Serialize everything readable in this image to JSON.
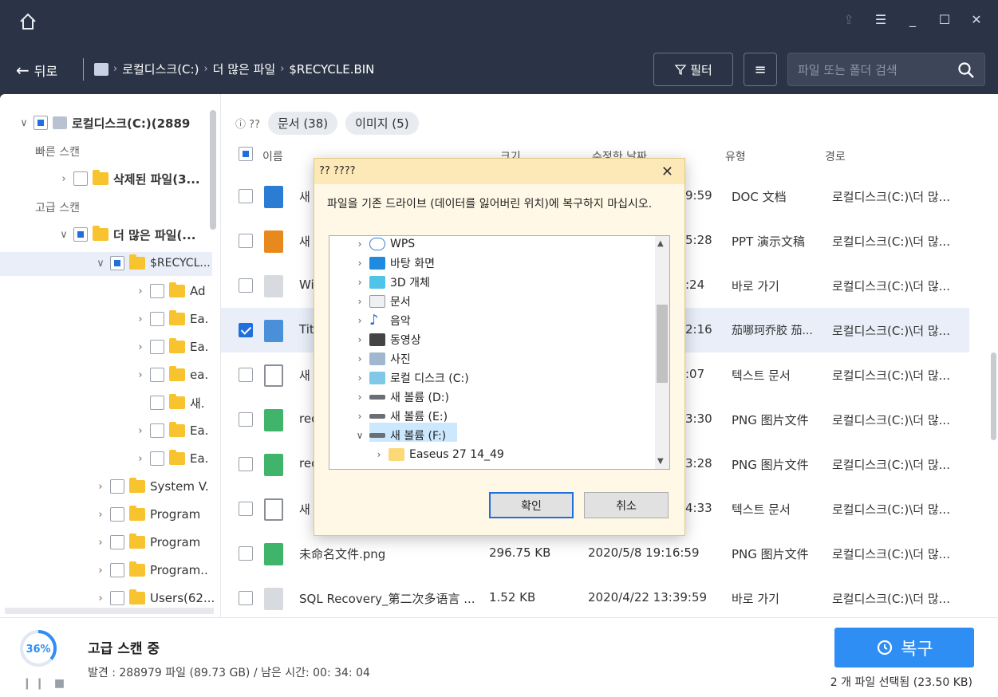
{
  "nav": {
    "back_label": "뒤로",
    "crumbs": [
      "로컬디스크(C:)",
      "더 많은 파일",
      "$RECYCLE.BIN"
    ],
    "filter_label": "필터",
    "search_placeholder": "파일 또는 폴더 검색"
  },
  "tree": {
    "root_label": "로컬디스크(C:)(2889",
    "quick_scan": "빠른 스캔",
    "deleted_files": "삭제된 파일(3...",
    "advanced_scan": "고급 스캔",
    "more_files": "더 많은 파일(...",
    "recycle": "$RECYCL...",
    "sub": [
      "Ad",
      "Ea.",
      "Ea.",
      "ea.",
      "새.",
      "Ea.",
      "Ea."
    ],
    "top": [
      "System V.",
      "Program",
      "Program",
      "Program..",
      "Users(62..."
    ]
  },
  "filters": {
    "help": "??",
    "documents": "문서 (38)",
    "images": "이미지 (5)"
  },
  "columns": {
    "name": "이름",
    "size": "크기",
    "date": "수정한 날짜",
    "type": "유형",
    "path": "경로"
  },
  "rows": [
    {
      "name": "새",
      "time": "9:59",
      "type": "DOC 文档",
      "path": "로컬디스크(C:)\\더 많..."
    },
    {
      "name": "새",
      "time": "5:28",
      "type": "PPT 演示文稿",
      "path": "로컬디스크(C:)\\더 많..."
    },
    {
      "name": "Wi",
      "time": ":24",
      "type": "바로 가기",
      "path": "로컬디스크(C:)\\더 많..."
    },
    {
      "name": "Tit",
      "time": "2:16",
      "type": "茄哪珂乔胶 茄...",
      "path": "로컬디스크(C:)\\더 많..."
    },
    {
      "name": "새",
      "time": ":07",
      "type": "텍스트 문서",
      "path": "로컬디스크(C:)\\더 많..."
    },
    {
      "name": "rec",
      "time": "3:30",
      "type": "PNG 图片文件",
      "path": "로컬디스크(C:)\\더 많..."
    },
    {
      "name": "rec",
      "time": "3:28",
      "type": "PNG 图片文件",
      "path": "로컬디스크(C:)\\더 많..."
    },
    {
      "name": "새",
      "time": "4:33",
      "type": "텍스트 문서",
      "path": "로컬디스크(C:)\\더 많..."
    },
    {
      "name": "未命名文件.png",
      "size": "296.75 KB",
      "date": "2020/5/8 19:16:59",
      "type": "PNG 图片文件",
      "path": "로컬디스크(C:)\\더 많..."
    },
    {
      "name": "SQL Recovery_第二次多语言 ...",
      "size": "1.52 KB",
      "date": "2020/4/22 13:39:59",
      "type": "바로 가기",
      "path": "로컬디스크(C:)\\더 많..."
    }
  ],
  "status": {
    "percent": "36%",
    "progress_fraction": 0.36,
    "title": "고급 스캔 중",
    "detail": "발견 : 288979 파일 (89.73 GB) / 남은 시간: 00: 34: 04",
    "recover_label": "복구",
    "selection": "2 개 파일 선택됨 (23.50 KB)"
  },
  "dialog": {
    "title": "?? ????",
    "message": "파일을 기존 드라이브 (데이터를 잃어버린 위치)에 복구하지 마십시오.",
    "items": [
      "WPS",
      "바탕 화면",
      "3D 개체",
      "문서",
      "음악",
      "동영상",
      "사진",
      "로컬 디스크 (C:)",
      "새 볼륨 (D:)",
      "새 볼륨 (E:)",
      "새 볼륨 (F:)",
      "Easeus 27 14_49"
    ],
    "ok_label": "확인",
    "cancel_label": "취소"
  },
  "colors": {
    "accent": "#2f8ef4",
    "dark_bg": "#2b3446",
    "dialog_title": "#fde9b8"
  }
}
